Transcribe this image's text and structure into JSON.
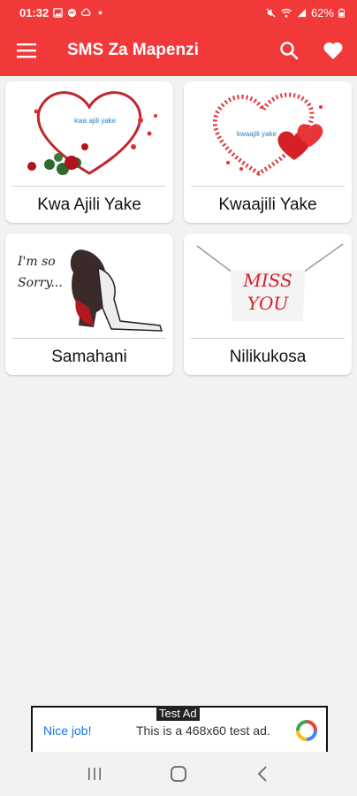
{
  "status_bar": {
    "time": "01:32",
    "battery": "62%",
    "icons": [
      "gallery-icon",
      "messenger-icon",
      "cloud-icon",
      "dot-icon",
      "mute-icon",
      "wifi-icon",
      "signal-icon",
      "battery-icon"
    ]
  },
  "app_bar": {
    "title": "SMS Za Mapenzi",
    "menu_icon": "menu-icon",
    "search_icon": "search-icon",
    "favorites_icon": "heart-icon"
  },
  "categories": [
    {
      "label": "Kwa Ajili Yake",
      "image_text": "kwa ajili yake"
    },
    {
      "label": "Kwaajili Yake",
      "image_text": "kwaajili yake"
    },
    {
      "label": "Samahani",
      "image_text": "I'm so Sorry..."
    },
    {
      "label": "Nilikukosa",
      "image_text": "MISS YOU"
    }
  ],
  "ad": {
    "badge": "Test Ad",
    "headline": "Nice job!",
    "body": "This is a 468x60 test ad."
  },
  "nav": {
    "recents_icon": "recents-icon",
    "home_icon": "home-icon",
    "back_icon": "back-icon"
  },
  "colors": {
    "primary": "#f2393a",
    "background": "#f2f2f2",
    "card": "#ffffff",
    "ad_link": "#1a73e8"
  }
}
